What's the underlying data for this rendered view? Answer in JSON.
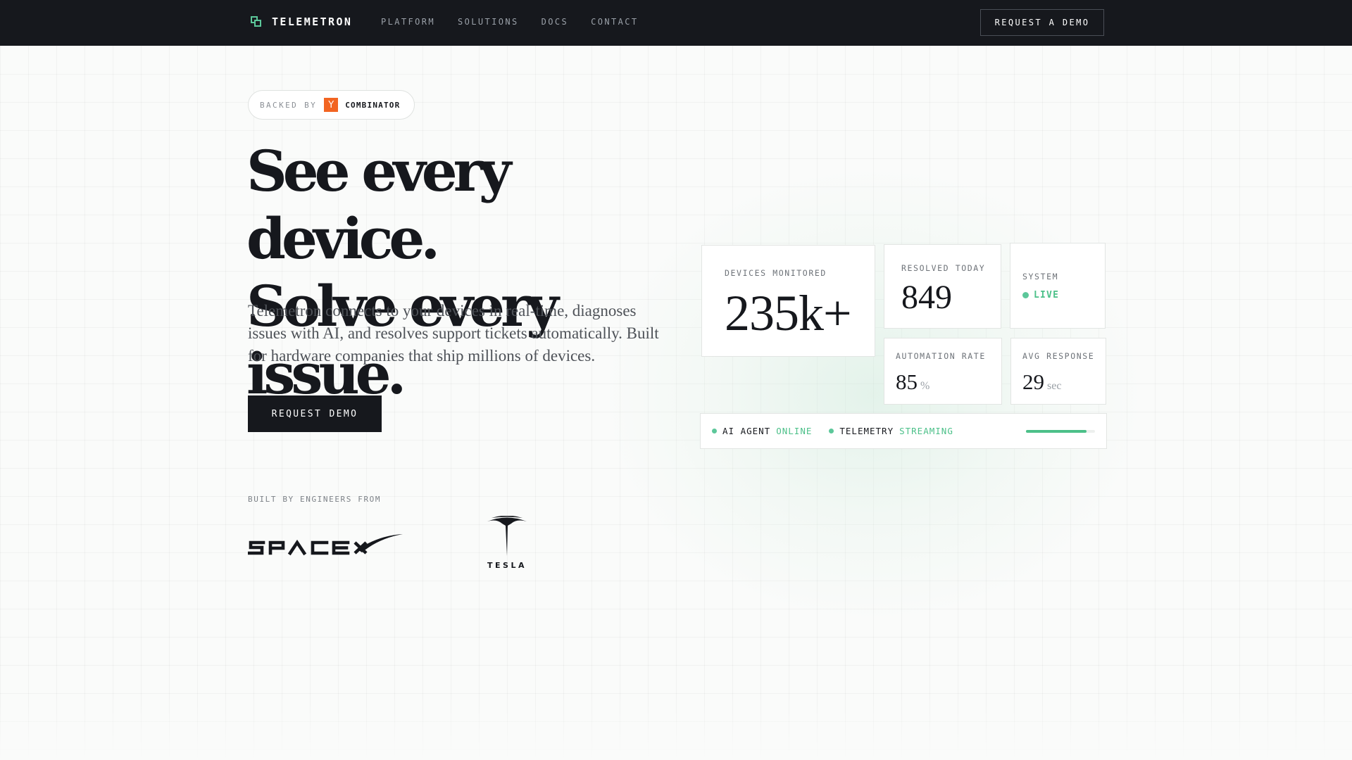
{
  "nav": {
    "brand": "TELEMETRON",
    "links": [
      "PLATFORM",
      "SOLUTIONS",
      "DOCS",
      "CONTACT"
    ],
    "cta": "REQUEST A DEMO"
  },
  "badge": {
    "label": "BACKED BY",
    "logo_letter": "Y",
    "brand": "COMBINATOR"
  },
  "hero": {
    "headline_line1": "See every device.",
    "headline_line2": "Solve every issue.",
    "subtext": "Telemetron connects to your devices in real-time, diagnoses issues with AI, and resolves support tickets automatically. Built for hardware companies that ship millions of devices.",
    "cta": "REQUEST DEMO"
  },
  "built_by": {
    "label": "BUILT BY ENGINEERS FROM",
    "logos": [
      {
        "name": "SPACEX",
        "icon": "spacex-logo"
      },
      {
        "name": "TESLA",
        "icon": "tesla-logo"
      }
    ]
  },
  "dashboard": {
    "devices": {
      "label": "DEVICES MONITORED",
      "value": "235k+"
    },
    "resolved": {
      "label": "RESOLVED TODAY",
      "value": "849"
    },
    "system": {
      "label": "SYSTEM",
      "status": "LIVE"
    },
    "automation": {
      "label": "AUTOMATION RATE",
      "value": "85",
      "unit": "%"
    },
    "response": {
      "label": "AVG RESPONSE",
      "value": "29",
      "unit": "sec"
    },
    "status_bar": {
      "agent_label": "AI AGENT",
      "agent_status": "ONLINE",
      "telemetry_label": "TELEMETRY",
      "telemetry_status": "STREAMING",
      "progress": 0.88
    }
  },
  "colors": {
    "accent": "#4cc089",
    "dark": "#16181d",
    "yc_orange": "#f26522"
  }
}
